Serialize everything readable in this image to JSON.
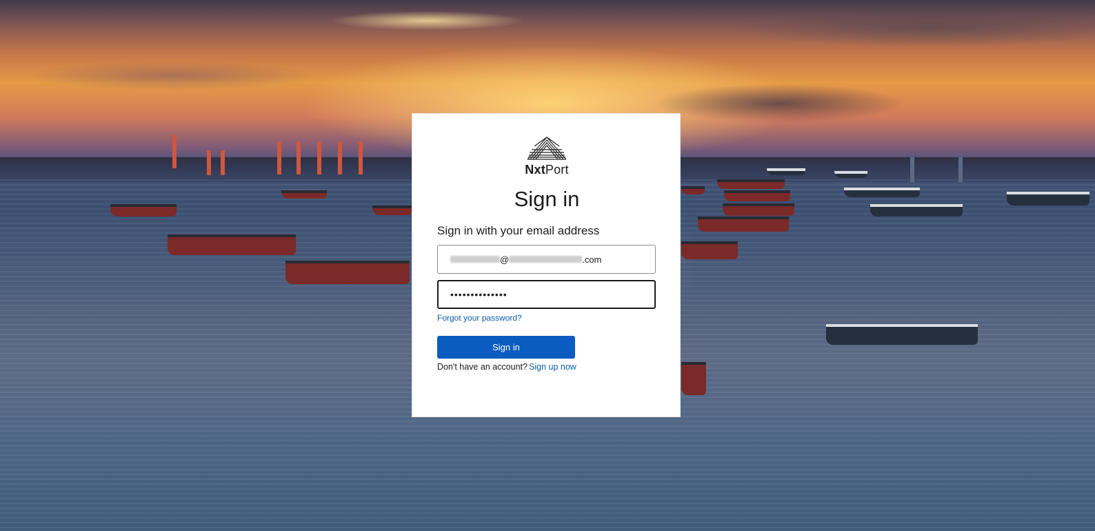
{
  "brand": {
    "logo_name": "nxtport-logo-icon",
    "name_bold": "Nxt",
    "name_light": "Port"
  },
  "login": {
    "title": "Sign in",
    "subtitle": "Sign in with your email address",
    "email_at": "@",
    "email_suffix": ".com",
    "password_mask": "••••••••••••••",
    "forgot_link": "Forgot your password?",
    "submit_label": "Sign in",
    "no_account_text": "Don't have an account?",
    "signup_link": "Sign up now"
  },
  "colors": {
    "primary_button": "#0b5cc0",
    "link": "#0b5cad"
  }
}
